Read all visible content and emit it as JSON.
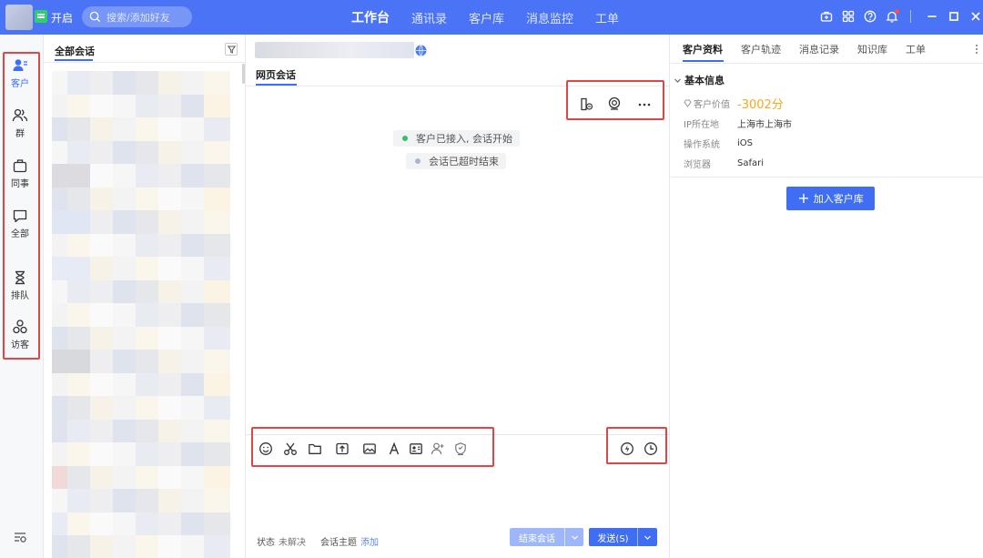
{
  "app": {
    "status_label": "开启",
    "search_placeholder": "搜索/添加好友",
    "nav": [
      "工作台",
      "通讯录",
      "客户库",
      "消息监控",
      "工单"
    ],
    "active_nav": "工作台",
    "accent": "#3f6ef5",
    "annotation_color": "#e04646"
  },
  "rail": {
    "items": [
      {
        "label": "客户",
        "icon": "customer-icon",
        "active": true
      },
      {
        "label": "群",
        "icon": "group-icon",
        "active": false
      },
      {
        "label": "同事",
        "icon": "colleague-icon",
        "active": false
      },
      {
        "label": "全部",
        "icon": "chat-bubble-icon",
        "active": false
      },
      {
        "label": "排队",
        "icon": "hourglass-icon",
        "active": false
      },
      {
        "label": "访客",
        "icon": "visitor-icon",
        "active": false
      }
    ]
  },
  "conversations": {
    "header": "全部会话"
  },
  "chat": {
    "tab": "网页会话",
    "system_messages": [
      {
        "text": "客户已接入, 会话开始",
        "dot_color": "#35c06d"
      },
      {
        "text": "会话已超时结束",
        "dot_color": "#a9b6d3"
      }
    ],
    "footer": {
      "status_label": "状态",
      "status_value": "未解决",
      "topic_label": "会话主题",
      "topic_action": "添加"
    },
    "end_button": "结束会话",
    "send_button": "发送(S)"
  },
  "customer_panel": {
    "tabs": [
      "客户资料",
      "客户轨迹",
      "消息记录",
      "知识库",
      "工单"
    ],
    "active_tab": "客户资料",
    "section": "基本信息",
    "fields": [
      {
        "key": "客户价值",
        "value": "-3002分"
      },
      {
        "key": "IP所在地",
        "value": "上海市上海市"
      },
      {
        "key": "操作系统",
        "value": "iOS"
      },
      {
        "key": "浏览器",
        "value": "Safari"
      }
    ],
    "add_button": "加入客户库"
  }
}
